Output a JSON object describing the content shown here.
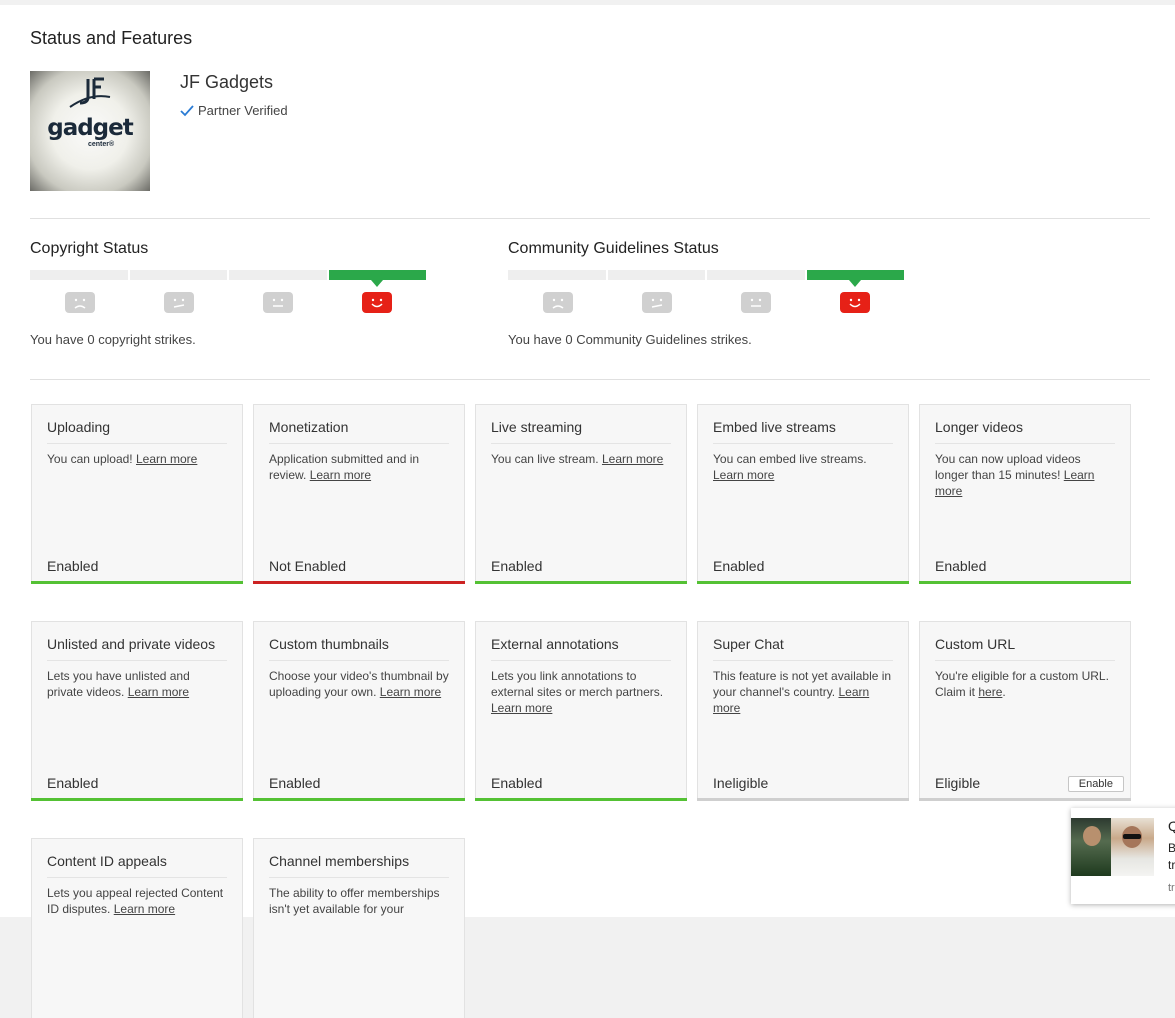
{
  "page": {
    "title": "Status and Features"
  },
  "channel": {
    "name": "JF Gadgets",
    "verified_label": "Partner Verified",
    "logo": {
      "mark": "JF",
      "word": "gadget",
      "sub": "center®"
    }
  },
  "copyright": {
    "title": "Copyright Status",
    "strikes_text": "You have 0 copyright strikes.",
    "active_segment": 4
  },
  "community": {
    "title": "Community Guidelines Status",
    "strikes_text": "You have 0 Community Guidelines strikes.",
    "active_segment": 4
  },
  "features": [
    {
      "title": "Uploading",
      "desc": "You can upload!",
      "link": "Learn more",
      "status": "Enabled",
      "state": "enabled"
    },
    {
      "title": "Monetization",
      "desc": "Application submitted and in review.",
      "link": "Learn more",
      "status": "Not Enabled",
      "state": "disabled"
    },
    {
      "title": "Live streaming",
      "desc": "You can live stream.",
      "link": "Learn more",
      "status": "Enabled",
      "state": "enabled"
    },
    {
      "title": "Embed live streams",
      "desc": "You can embed live streams.",
      "link": "Learn more",
      "status": "Enabled",
      "state": "enabled"
    },
    {
      "title": "Longer videos",
      "desc": "You can now upload videos longer than 15 minutes!",
      "link": "Learn more",
      "status": "Enabled",
      "state": "enabled"
    },
    {
      "title": "Unlisted and private videos",
      "desc": "Lets you have unlisted and private videos.",
      "link": "Learn more",
      "status": "Enabled",
      "state": "enabled"
    },
    {
      "title": "Custom thumbnails",
      "desc": "Choose your video's thumbnail by uploading your own.",
      "link": "Learn more",
      "status": "Enabled",
      "state": "enabled"
    },
    {
      "title": "External annotations",
      "desc": "Lets you link annotations to external sites or merch partners.",
      "link": "Learn more",
      "status": "Enabled",
      "state": "enabled"
    },
    {
      "title": "Super Chat",
      "desc": "This feature is not yet available in your channel's country.",
      "link": "Learn more",
      "status": "Ineligible",
      "state": "neutral"
    },
    {
      "title": "Custom URL",
      "desc": "You're eligible for a custom URL. Claim it",
      "link": "here",
      "suffix": ".",
      "status": "Eligible",
      "state": "neutral",
      "button": "Enable"
    },
    {
      "title": "Content ID appeals",
      "desc": "Lets you appeal rejected Content ID disputes.",
      "link": "Learn more",
      "status": "",
      "state": "neutral"
    },
    {
      "title": "Channel memberships",
      "desc": "The ability to offer memberships isn't yet available for your",
      "link": "",
      "status": "",
      "state": "neutral"
    }
  ],
  "popup": {
    "line1": "Q",
    "line2": "B",
    "line3": "tr",
    "line4": "tr"
  },
  "colors": {
    "enabled": "#54c134",
    "disabled": "#cc2222",
    "strike_active": "#2ba84a",
    "face_active": "#e62117"
  }
}
